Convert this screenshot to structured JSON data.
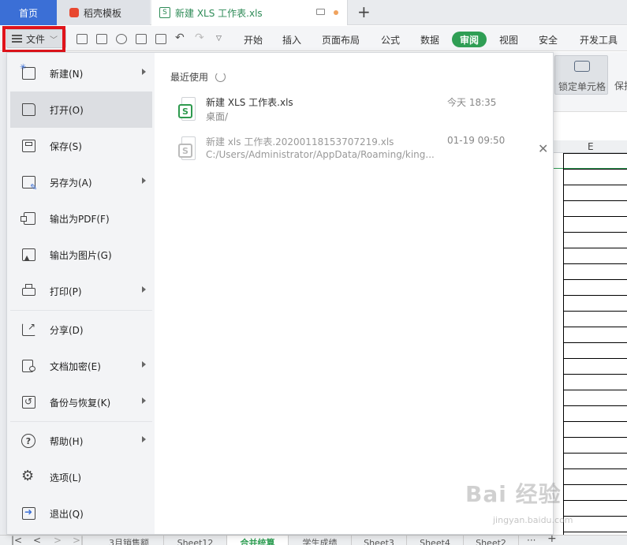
{
  "tabs": {
    "home": "首页",
    "template": "稻壳模板",
    "document": "新建 XLS 工作表.xls",
    "document_icon": "S"
  },
  "toolbar": {
    "file_label": "文件",
    "ribbon": [
      "开始",
      "插入",
      "页面布局",
      "公式",
      "数据",
      "审阅",
      "视图",
      "安全",
      "开发工具"
    ],
    "active_ribbon": "审阅",
    "active_color": "#2f9e54"
  },
  "review_ribbon": {
    "lock_cells": "锁定单元格",
    "protect": "保护"
  },
  "sheet": {
    "column_header": "E"
  },
  "file_menu": {
    "items": [
      {
        "label": "新建(N)",
        "icon": "new-icon",
        "submenu": true
      },
      {
        "label": "打开(O)",
        "icon": "folder-icon",
        "submenu": false,
        "active": true
      },
      {
        "label": "保存(S)",
        "icon": "save-icon",
        "submenu": false
      },
      {
        "label": "另存为(A)",
        "icon": "save-as-icon",
        "submenu": true
      },
      {
        "label": "输出为PDF(F)",
        "icon": "pdf-icon",
        "submenu": false
      },
      {
        "label": "输出为图片(G)",
        "icon": "image-icon",
        "submenu": false
      },
      {
        "label": "打印(P)",
        "icon": "printer-icon",
        "submenu": true
      },
      {
        "label": "分享(D)",
        "icon": "share-icon",
        "submenu": false
      },
      {
        "label": "文档加密(E)",
        "icon": "encrypt-icon",
        "submenu": true
      },
      {
        "label": "备份与恢复(K)",
        "icon": "backup-icon",
        "submenu": true
      },
      {
        "label": "帮助(H)",
        "icon": "help-icon",
        "submenu": true
      },
      {
        "label": "选项(L)",
        "icon": "gear-icon",
        "submenu": false
      },
      {
        "label": "退出(Q)",
        "icon": "exit-icon",
        "submenu": false
      }
    ]
  },
  "recent": {
    "title": "最近使用",
    "files": [
      {
        "name": "新建 XLS 工作表.xls",
        "path": "桌面/",
        "time": "今天 18:35"
      },
      {
        "name": "新建 xls 工作表.20200118153707219.xls",
        "path": "C:/Users/Administrator/AppData/Roaming/king...",
        "time": "01-19 09:50"
      }
    ]
  },
  "sheet_tabs": [
    "3月销售额",
    "Sheet12",
    "合并统算",
    "学生成绩",
    "Sheet3",
    "Sheet4",
    "Sheet2"
  ],
  "active_sheet": "合并统算",
  "watermark": {
    "text": "Bai 经验",
    "sub": "jingyan.baidu.com"
  }
}
